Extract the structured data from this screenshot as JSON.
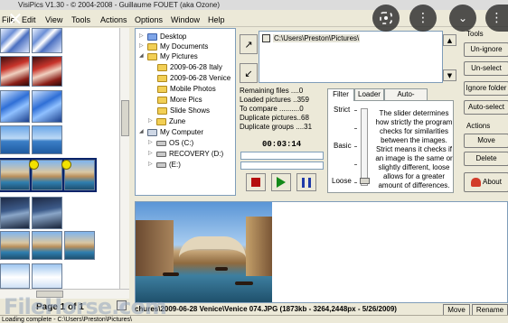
{
  "window": {
    "title": "VisiPics V1.30 - © 2004-2008 - Guillaume FOUET (aka Ozone)"
  },
  "menu": [
    "File",
    "Edit",
    "View",
    "Tools",
    "Actions",
    "Options",
    "Window",
    "Help"
  ],
  "overlay": {
    "close": "✕"
  },
  "tree": {
    "items": [
      {
        "label": "Desktop",
        "icon": "desktop-icon"
      },
      {
        "label": "My Documents",
        "icon": "folder-icon"
      },
      {
        "label": "My Pictures",
        "icon": "folder-open-icon"
      },
      {
        "label": "2009-06-28 Italy",
        "icon": "folder-icon"
      },
      {
        "label": "2009-06-28 Venice",
        "icon": "folder-icon"
      },
      {
        "label": "Mobile Photos",
        "icon": "folder-icon"
      },
      {
        "label": "More Pics",
        "icon": "folder-icon"
      },
      {
        "label": "Slide Shows",
        "icon": "folder-icon"
      },
      {
        "label": "Zune",
        "icon": "folder-icon"
      },
      {
        "label": "My Computer",
        "icon": "computer-icon"
      },
      {
        "label": "OS (C:)",
        "icon": "drive-icon"
      },
      {
        "label": "RECOVERY (D:)",
        "icon": "drive-icon"
      },
      {
        "label": "(E:)",
        "icon": "drive-icon"
      }
    ]
  },
  "path": {
    "selected": "C:\\Users\\Preston\\Pictures\\"
  },
  "stats": {
    "remaining": "Remaining files ....0",
    "loaded": "Loaded pictures ..359",
    "to_compare": "To compare ..........0",
    "duplicate_pictures": "Duplicate pictures..68",
    "duplicate_groups": "Duplicate groups ....31",
    "timer": "00:03:14"
  },
  "tabs": {
    "items": [
      "Filter",
      "Loader",
      "Auto-Select"
    ],
    "active": "Filter",
    "filter": {
      "strict": "Strict",
      "basic": "Basic",
      "loose": "Loose",
      "explanation": "The slider determines how strictly the program checks for similarities between the images. Strict means it checks if an image is the same or slightly different, loose allows for a greater amount of differences."
    }
  },
  "tools": {
    "header": "Tools",
    "buttons": [
      "Un-ignore",
      "Un-select",
      "Ignore folder",
      "Auto-select"
    ]
  },
  "actions": {
    "header": "Actions",
    "buttons": [
      "Move",
      "Delete"
    ],
    "about": "About"
  },
  "thumbs": {
    "page_label": "Page 1 of 1"
  },
  "preview": {
    "file_info": "chures\\2009-06-28 Venice\\Venice 074.JPG (1873kb - 3264,2448px - 5/26/2009)"
  },
  "bottom_buttons": [
    "Move",
    "Rename"
  ],
  "status": {
    "text": "Loading complete - C:\\Users\\Preston\\Pictures\\"
  },
  "watermark": "FileHorse.com"
}
